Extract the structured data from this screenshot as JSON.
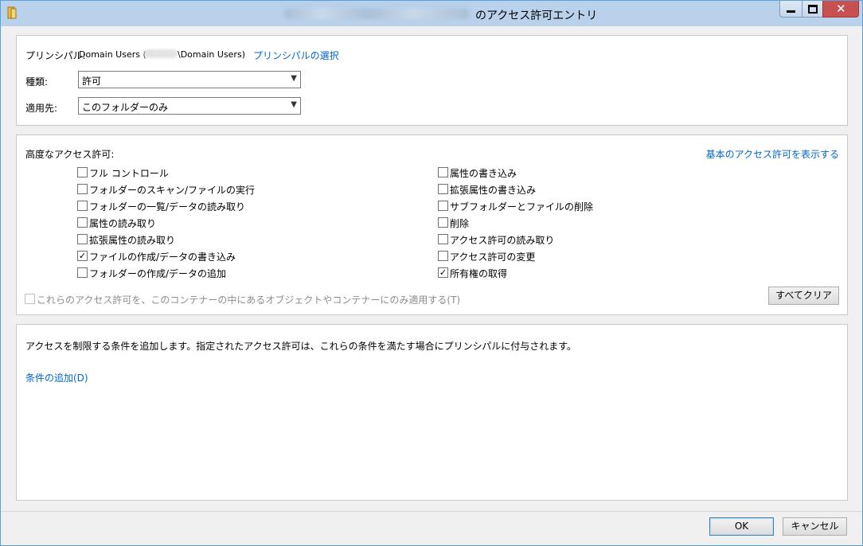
{
  "window": {
    "title_suffix": "のアクセス許可エントリ"
  },
  "principal": {
    "label": "プリンシパル:",
    "name_prefix": "Domain Users (",
    "name_suffix": "\\Domain Users)",
    "select_link": "プリンシパルの選択"
  },
  "type": {
    "label": "種類:",
    "value": "許可"
  },
  "applies_to": {
    "label": "適用先:",
    "value": "このフォルダーのみ"
  },
  "advanced": {
    "heading": "高度なアクセス許可:",
    "show_basic_link": "基本のアクセス許可を表示する",
    "left": [
      {
        "label": "フル コントロール",
        "checked": false
      },
      {
        "label": "フォルダーのスキャン/ファイルの実行",
        "checked": false
      },
      {
        "label": "フォルダーの一覧/データの読み取り",
        "checked": false
      },
      {
        "label": "属性の読み取り",
        "checked": false
      },
      {
        "label": "拡張属性の読み取り",
        "checked": false
      },
      {
        "label": "ファイルの作成/データの書き込み",
        "checked": true
      },
      {
        "label": "フォルダーの作成/データの追加",
        "checked": false
      }
    ],
    "right": [
      {
        "label": "属性の書き込み",
        "checked": false
      },
      {
        "label": "拡張属性の書き込み",
        "checked": false
      },
      {
        "label": "サブフォルダーとファイルの削除",
        "checked": false
      },
      {
        "label": "削除",
        "checked": false
      },
      {
        "label": "アクセス許可の読み取り",
        "checked": false
      },
      {
        "label": "アクセス許可の変更",
        "checked": false
      },
      {
        "label": "所有権の取得",
        "checked": true
      }
    ],
    "apply_only_label": "これらのアクセス許可を、このコンテナーの中にあるオブジェクトやコンテナーにのみ適用する(T)",
    "clear_all": "すべてクリア"
  },
  "conditions": {
    "description": "アクセスを制限する条件を追加します。指定されたアクセス許可は、これらの条件を満たす場合にプリンシパルに付与されます。",
    "add_link": "条件の追加(D)"
  },
  "footer": {
    "ok": "OK",
    "cancel": "キャンセル"
  },
  "icons": {
    "title": "folder-icon",
    "minimize": "minimize-icon",
    "maximize": "maximize-icon",
    "close": "close-icon"
  }
}
